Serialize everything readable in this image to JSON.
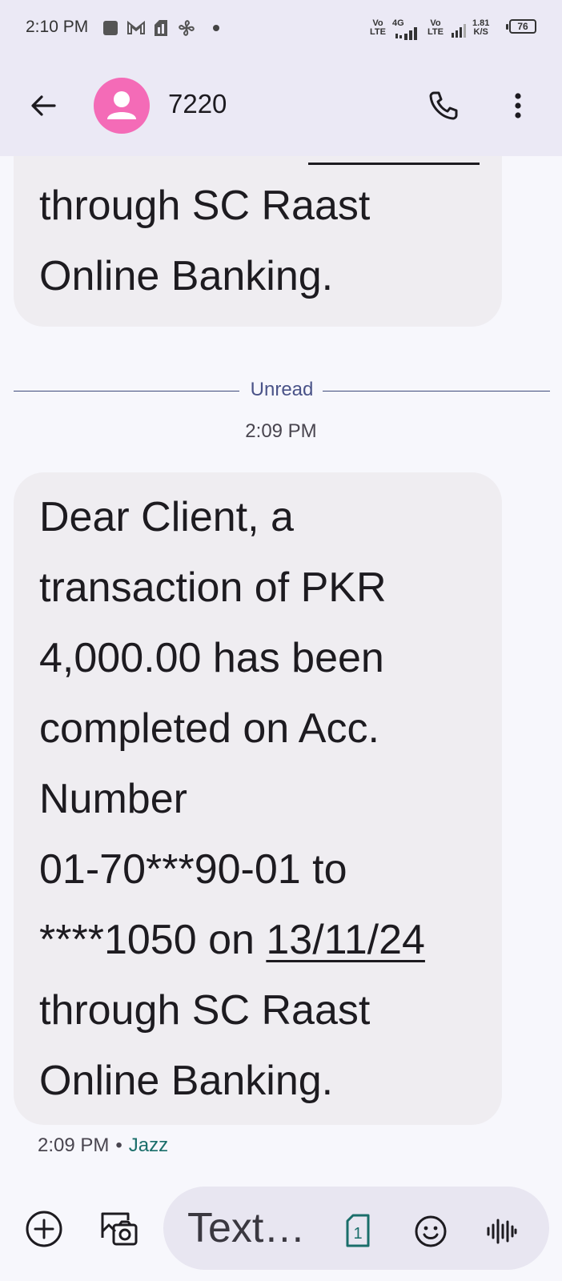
{
  "status_bar": {
    "time": "2:10 PM",
    "net1_top": "Vo",
    "net1_bottom": "LTE",
    "net_gen": "4G",
    "net2_top": "Vo",
    "net2_bottom": "LTE",
    "speed_value": "1.81",
    "speed_unit": "K/S",
    "battery": "76"
  },
  "app_bar": {
    "contact": "7220"
  },
  "messages": {
    "partial_text": "through SC Raast\nOnline Banking.",
    "unread_label": "Unread",
    "timestamp": "2:09 PM",
    "main_text_before_date": "Dear Client, a\ntransaction of PKR\n4,000.00 has been\ncompleted on Acc.\nNumber\n01-70***90-01 to\n****1050 on ",
    "main_date": "13/11/24",
    "main_text_after_date": "\nthrough SC Raast\nOnline Banking.",
    "meta_time": "2:09 PM",
    "meta_separator": "•",
    "meta_carrier": "Jazz"
  },
  "composer": {
    "placeholder": "Text…",
    "sim_number": "1"
  },
  "icons": {
    "back": "arrow-left-icon",
    "avatar": "person-icon",
    "call": "phone-icon",
    "more": "more-vert-icon",
    "add": "add-circle-icon",
    "media": "gallery-camera-icon",
    "sim": "sim-card-icon",
    "emoji": "emoji-icon",
    "voice": "voice-waveform-icon"
  },
  "colors": {
    "avatar": "#f46bb7",
    "bubble": "#efedf1",
    "header": "#ebe9f5",
    "carrier": "#1a6e6a",
    "sim": "#1a6e6a"
  }
}
